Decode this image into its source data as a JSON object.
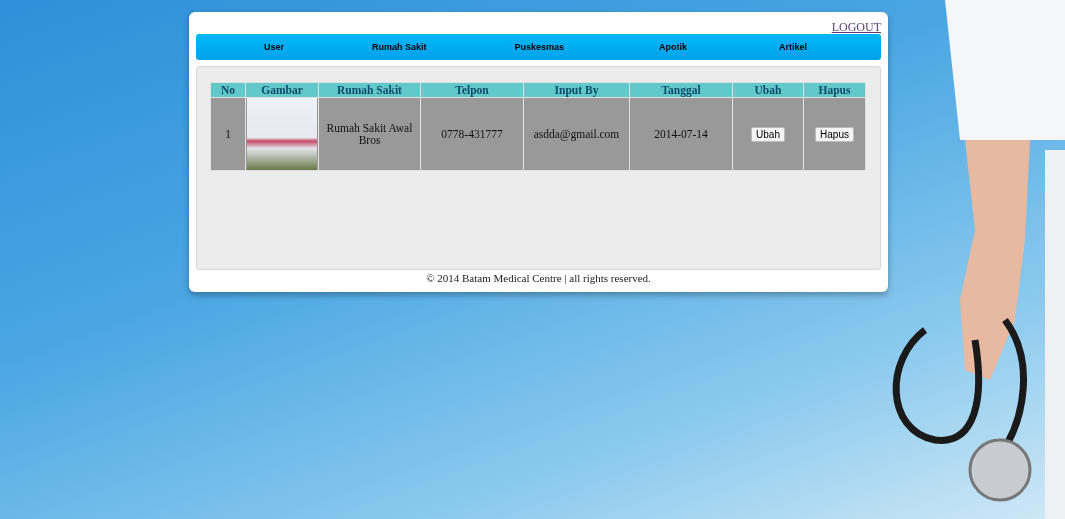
{
  "logout": "LOGOUT",
  "nav": [
    {
      "label": "User"
    },
    {
      "label": "Rumah Sakit"
    },
    {
      "label": "Puskesmas"
    },
    {
      "label": "Apotik"
    },
    {
      "label": "Artikel"
    }
  ],
  "table": {
    "columns": [
      "No",
      "Gambar",
      "Rumah Sakit",
      "Telpon",
      "Input By",
      "Tanggal",
      "Ubah",
      "Hapus"
    ],
    "rows": [
      {
        "no": "1",
        "rumah_sakit": "Rumah Sakit Awal Bros",
        "telpon": "0778-431777",
        "input_by": "asdda@gmail.com",
        "tanggal": "2014-07-14",
        "ubah": "Ubah",
        "hapus": "Hapus"
      }
    ]
  },
  "footer": "© 2014 Batam Medical Centre | all rights reserved."
}
